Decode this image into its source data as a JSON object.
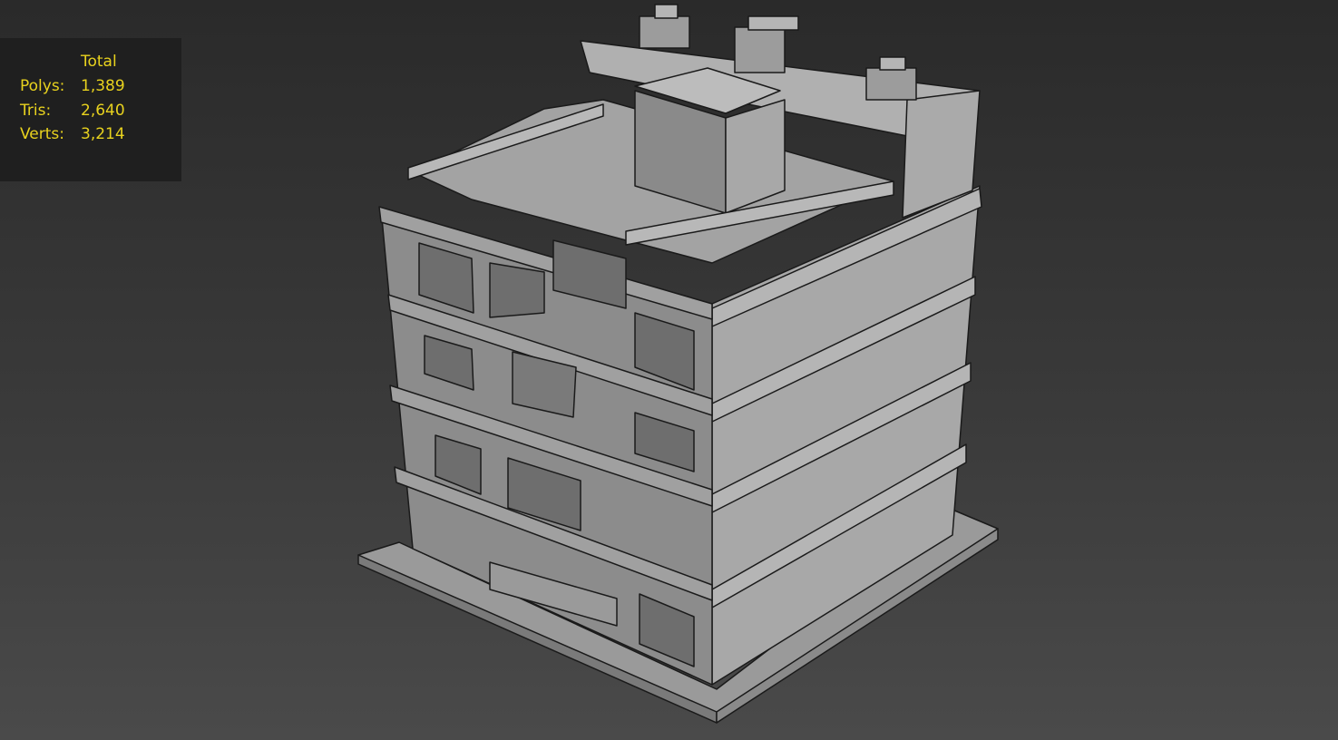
{
  "viewport": {
    "type": "3d-perspective",
    "shading": "gray",
    "background": "#333333"
  },
  "stats": {
    "header": "Total",
    "rows": [
      {
        "label": "Polys:",
        "value": "1,389"
      },
      {
        "label": "Tris:",
        "value": "2,640"
      },
      {
        "label": "Verts:",
        "value": "3,214"
      }
    ],
    "color": "#e8d21e"
  }
}
